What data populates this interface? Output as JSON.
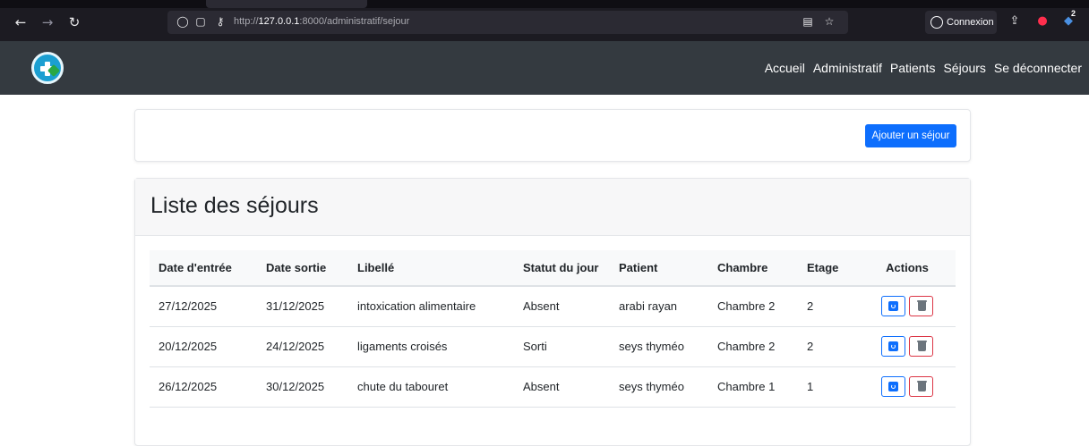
{
  "browser": {
    "url_prefix": "http://",
    "url_host": "127.0.0.1",
    "url_rest": ":8000/administratif/sejour",
    "connexion_label": "Connexion",
    "badge_count": "2"
  },
  "navbar": {
    "links": [
      "Accueil",
      "Administratif",
      "Patients",
      "Séjours",
      "Se déconnecter"
    ]
  },
  "toolbar": {
    "add_label": "Ajouter un séjour"
  },
  "list": {
    "title": "Liste des séjours",
    "columns": [
      "Date d'entrée",
      "Date sortie",
      "Libellé",
      "Statut du jour",
      "Patient",
      "Chambre",
      "Etage",
      "Actions"
    ],
    "rows": [
      {
        "entree": "27/12/2025",
        "sortie": "31/12/2025",
        "libelle": "intoxication alimentaire",
        "statut": "Absent",
        "patient": "arabi rayan",
        "chambre": "Chambre 2",
        "etage": "2"
      },
      {
        "entree": "20/12/2025",
        "sortie": "24/12/2025",
        "libelle": "ligaments croisés",
        "statut": "Sorti",
        "patient": "seys thyméo",
        "chambre": "Chambre 2",
        "etage": "2"
      },
      {
        "entree": "26/12/2025",
        "sortie": "30/12/2025",
        "libelle": "chute du tabouret",
        "statut": "Absent",
        "patient": "seys thyméo",
        "chambre": "Chambre 1",
        "etage": "1"
      }
    ]
  },
  "colors": {
    "navbar_bg": "#343a40",
    "primary": "#0d6efd",
    "danger": "#dc3545"
  }
}
